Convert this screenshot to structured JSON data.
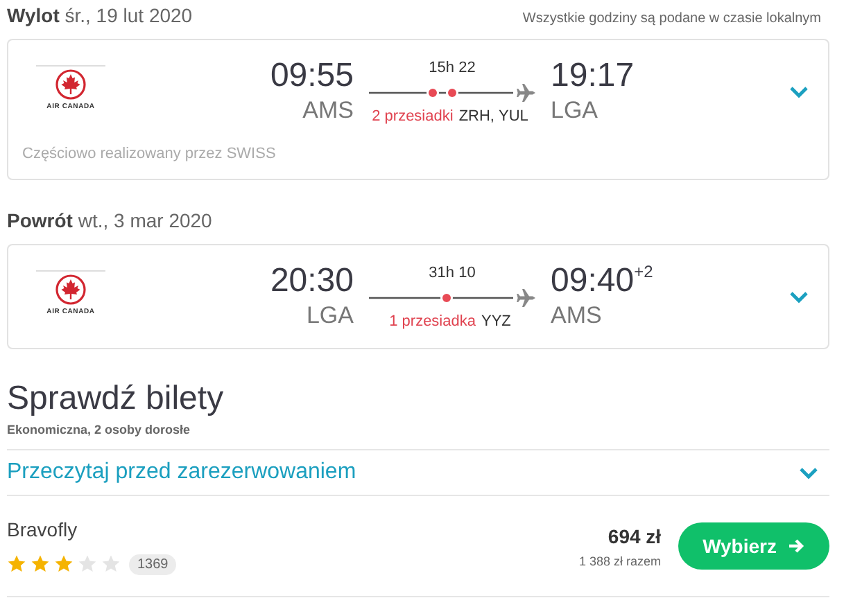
{
  "note": "Wszystkie godziny są podane w czasie lokalnym",
  "legs": [
    {
      "label": "Wylot",
      "date": "śr., 19 lut 2020",
      "logo_text": "AIR CANADA",
      "departure_time": "09:55",
      "departure_airport": "AMS",
      "duration": "15h 22",
      "stops_label": "2 przesiadki",
      "stops": [
        {
          "code": "ZRH,"
        },
        {
          "code": "YUL"
        }
      ],
      "arrival_time": "19:17",
      "arrival_airport": "LGA",
      "operated_by": "Częściowo realizowany przez SWISS"
    },
    {
      "label": "Powrót",
      "date": "wt., 3 mar 2020",
      "logo_text": "AIR CANADA",
      "departure_time": "20:30",
      "departure_airport": "LGA",
      "duration": "31h 10",
      "stops_label": "1 przesiadka",
      "stops": [
        {
          "code": "YYZ"
        }
      ],
      "arrival_time": "09:40",
      "arrival_day_offset": "+2",
      "arrival_airport": "AMS"
    }
  ],
  "tickets": {
    "title": "Sprawdź bilety",
    "subtitle": "Ekonomiczna, 2 osoby dorosłe",
    "info_link": "Przeczytaj przed zarezerwowaniem",
    "offers": [
      {
        "provider": "Bravofly",
        "stars": 3,
        "reviews": "1369",
        "price": "694 zł",
        "total": "1 388 zł razem",
        "button": "Wybierz"
      }
    ]
  }
}
